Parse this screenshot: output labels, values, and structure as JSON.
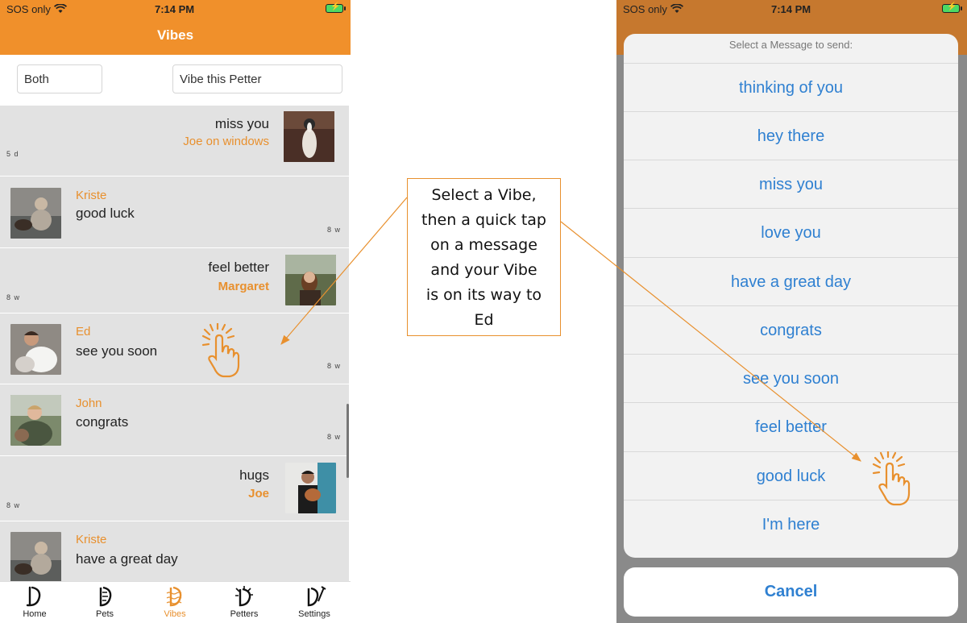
{
  "status": {
    "carrier": "SOS only",
    "time": "7:14 PM"
  },
  "header": {
    "title": "Vibes"
  },
  "filters": {
    "scope": "Both",
    "action": "Vibe this Petter"
  },
  "feed": [
    {
      "message": "miss you",
      "sender": "Joe on windows",
      "age": "5 d"
    },
    {
      "message": "good luck",
      "sender": "Kriste",
      "age": "8 w"
    },
    {
      "message": "feel better",
      "sender": "Margaret",
      "age": "8 w"
    },
    {
      "message": "see you soon",
      "sender": "Ed",
      "age": "8 w"
    },
    {
      "message": "congrats",
      "sender": "John",
      "age": "8 w"
    },
    {
      "message": "hugs",
      "sender": "Joe",
      "age": "8 w"
    },
    {
      "message": "have a great day",
      "sender": "Kriste",
      "age": ""
    }
  ],
  "tabs": [
    {
      "label": "Home"
    },
    {
      "label": "Pets"
    },
    {
      "label": "Vibes"
    },
    {
      "label": "Petters"
    },
    {
      "label": "Settings"
    }
  ],
  "annotation": {
    "lines": [
      "Select a Vibe,",
      "then a quick tap",
      "on a message",
      "and your Vibe",
      "is on its way to",
      "Ed"
    ]
  },
  "sheet": {
    "title": "Select a Message to send:",
    "options": [
      "thinking of you",
      "hey there",
      "miss you",
      "love you",
      "have a great day",
      "congrats",
      "see you soon",
      "feel better",
      "good luck",
      "I'm here"
    ],
    "cancel": "Cancel"
  },
  "colors": {
    "accent": "#f0902b",
    "link": "#2f80d1",
    "row": "#e2e2e2"
  }
}
